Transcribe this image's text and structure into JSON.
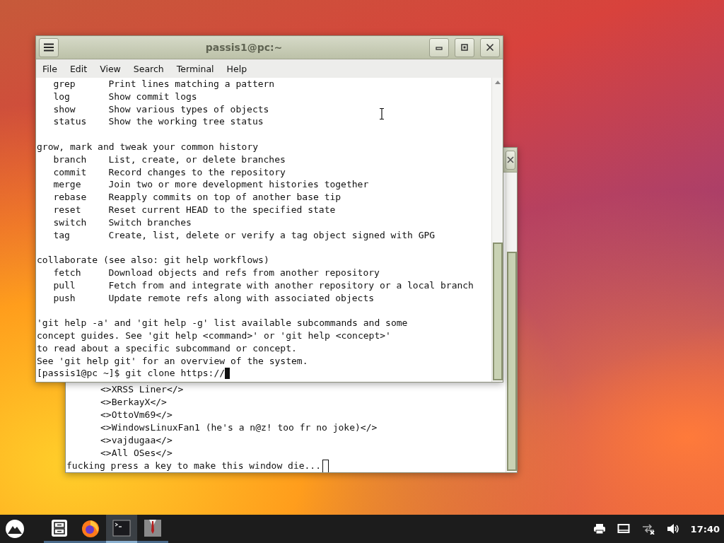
{
  "back_window": {
    "lines": [
      {
        "kind": "tag",
        "text": "<>XRSS Liner</>"
      },
      {
        "kind": "tag",
        "text": "<>BerkayX</>"
      },
      {
        "kind": "tag",
        "text": "<>OttoVm69</>"
      },
      {
        "kind": "tag",
        "text": "<>WindowsLinuxFan1 (he's a n@z! too fr no joke)</>"
      },
      {
        "kind": "tag",
        "text": "<>vajdugaa</>"
      },
      {
        "kind": "tag",
        "text": "<>All OSes</>"
      },
      {
        "kind": "plain",
        "text": "fucking press a key to make this window die..."
      }
    ]
  },
  "terminal": {
    "title": "passis1@pc:~",
    "menu": [
      "File",
      "Edit",
      "View",
      "Search",
      "Terminal",
      "Help"
    ],
    "blocks": [
      [
        {
          "kind": "command",
          "command": "grep",
          "description": "Print lines matching a pattern"
        },
        {
          "kind": "command",
          "command": "log",
          "description": "Show commit logs"
        },
        {
          "kind": "command",
          "command": "show",
          "description": "Show various types of objects"
        },
        {
          "kind": "command",
          "command": "status",
          "description": "Show the working tree status"
        }
      ],
      [
        {
          "kind": "plain",
          "text": "grow, mark and tweak your common history"
        },
        {
          "kind": "command",
          "command": "branch",
          "description": "List, create, or delete branches"
        },
        {
          "kind": "command",
          "command": "commit",
          "description": "Record changes to the repository"
        },
        {
          "kind": "command",
          "command": "merge",
          "description": "Join two or more development histories together"
        },
        {
          "kind": "command",
          "command": "rebase",
          "description": "Reapply commits on top of another base tip"
        },
        {
          "kind": "command",
          "command": "reset",
          "description": "Reset current HEAD to the specified state"
        },
        {
          "kind": "command",
          "command": "switch",
          "description": "Switch branches"
        },
        {
          "kind": "command",
          "command": "tag",
          "description": "Create, list, delete or verify a tag object signed with GPG"
        }
      ],
      [
        {
          "kind": "plain",
          "text": "collaborate (see also: git help workflows)"
        },
        {
          "kind": "command",
          "command": "fetch",
          "description": "Download objects and refs from another repository"
        },
        {
          "kind": "command",
          "command": "pull",
          "description": "Fetch from and integrate with another repository or a local branch"
        },
        {
          "kind": "command",
          "command": "push",
          "description": "Update remote refs along with associated objects"
        }
      ],
      [
        {
          "kind": "plain",
          "text": "'git help -a' and 'git help -g' list available subcommands and some"
        },
        {
          "kind": "plain",
          "text": "concept guides. See 'git help <command>' or 'git help <concept>'"
        },
        {
          "kind": "plain",
          "text": "to read about a specific subcommand or concept."
        },
        {
          "kind": "plain",
          "text": "See 'git help git' for an overview of the system."
        },
        {
          "kind": "prompt",
          "prompt": "[passis1@pc ~]$",
          "input": "git clone https://"
        }
      ]
    ]
  },
  "taskbar": {
    "apps": [
      {
        "kind": "files",
        "selected": false
      },
      {
        "kind": "browser",
        "selected": false
      },
      {
        "kind": "terminal",
        "selected": true
      },
      {
        "kind": "suit",
        "selected": false
      }
    ],
    "clock": "17:40"
  }
}
